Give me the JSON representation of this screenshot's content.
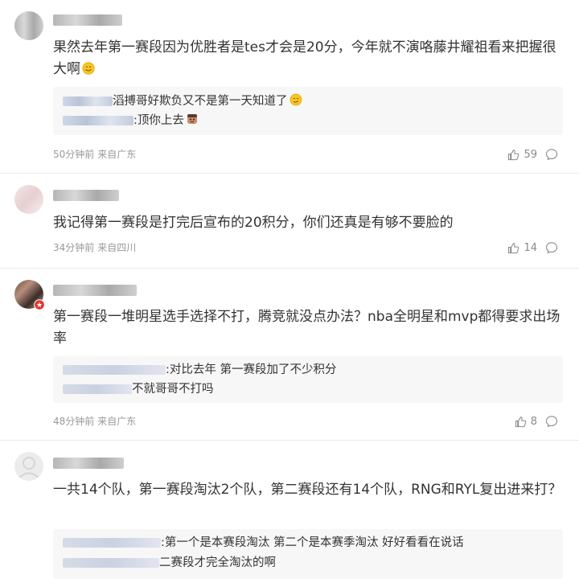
{
  "comments": [
    {
      "text": "果然去年第一赛段因为优胜者是tes才会是20分，今年就不演咯藤井耀祖看来把握很大啊",
      "replies": [
        {
          "text": "滔搏哥好欺负又不是第一天知道了"
        },
        {
          "text": ":顶你上去"
        }
      ],
      "time": "50分钟前",
      "location": "来自广东",
      "likes": "59"
    },
    {
      "text": "我记得第一赛段是打完后宣布的20积分，你们还真是有够不要脸的",
      "replies": [],
      "time": "34分钟前",
      "location": "来自四川",
      "likes": "14"
    },
    {
      "text": "第一赛段一堆明星选手选择不打，腾竞就没点办法？nba全明星和mvp都得要求出场率",
      "replies": [
        {
          "text": ":对比去年 第一赛段加了不少积分"
        },
        {
          "text": "不就哥哥不打吗"
        }
      ],
      "time": "48分钟前",
      "location": "来自广东",
      "likes": "8"
    },
    {
      "text": "一共14个队，第一赛段淘汰2个队，第二赛段还有14个队，RNG和RYL复出进来打？",
      "replies": [
        {
          "text": ":第一个是本赛段淘汰 第二个是本赛季淘汰 好好看看在说话"
        },
        {
          "text": "二赛段才完全淘汰的啊"
        }
      ]
    }
  ],
  "icons": {
    "like": "thumbs-up-icon",
    "comment": "comment-bubble-icon"
  },
  "colors": {
    "text": "#333333",
    "meta": "#999999",
    "reply_bg": "#f7f7f7",
    "divider": "#ebebeb"
  }
}
